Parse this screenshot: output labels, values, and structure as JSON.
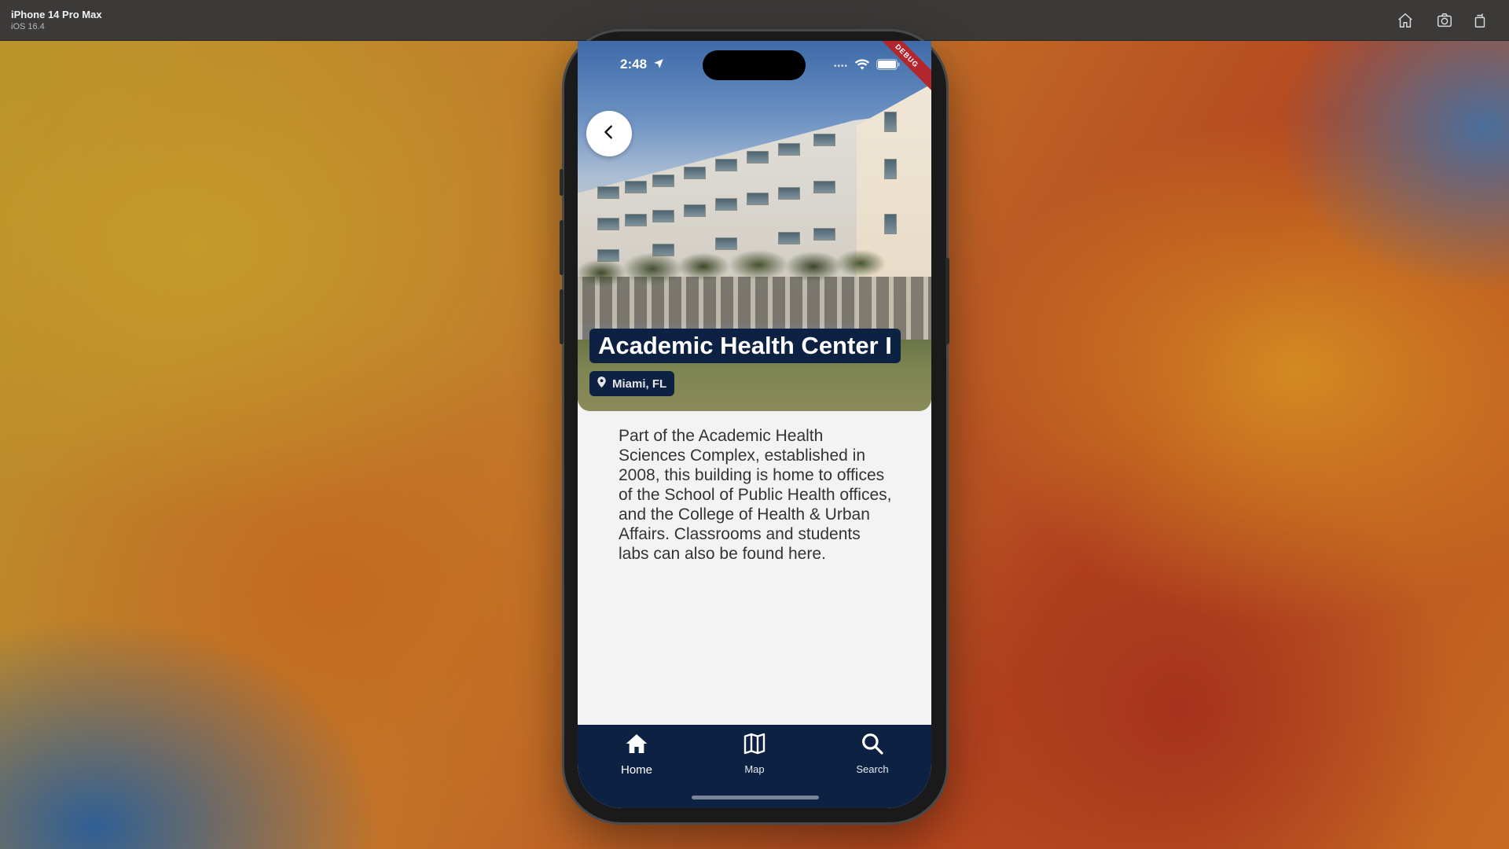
{
  "simulator": {
    "device": "iPhone 14 Pro Max",
    "os": "iOS 16.4",
    "icons": [
      "home-icon",
      "screenshot-icon",
      "rotate-icon"
    ]
  },
  "status_bar": {
    "time": "2:48",
    "debug_label": "DEBUG"
  },
  "detail": {
    "title": "Academic Health Center I",
    "location": "Miami, FL",
    "description": "Part of the Academic Health Sciences Complex, established in 2008, this building is home to offices of the School of Public Health offices, and the College of Health & Urban Affairs. Classrooms and students labs can also be found here."
  },
  "nav": {
    "items": [
      {
        "label": "Home",
        "icon": "home-icon",
        "active": true
      },
      {
        "label": "Map",
        "icon": "map-icon",
        "active": false
      },
      {
        "label": "Search",
        "icon": "search-icon",
        "active": false
      }
    ]
  },
  "colors": {
    "navy": "#0d2143",
    "debug_red": "#b3262d",
    "content_bg": "#f3f3f3"
  }
}
